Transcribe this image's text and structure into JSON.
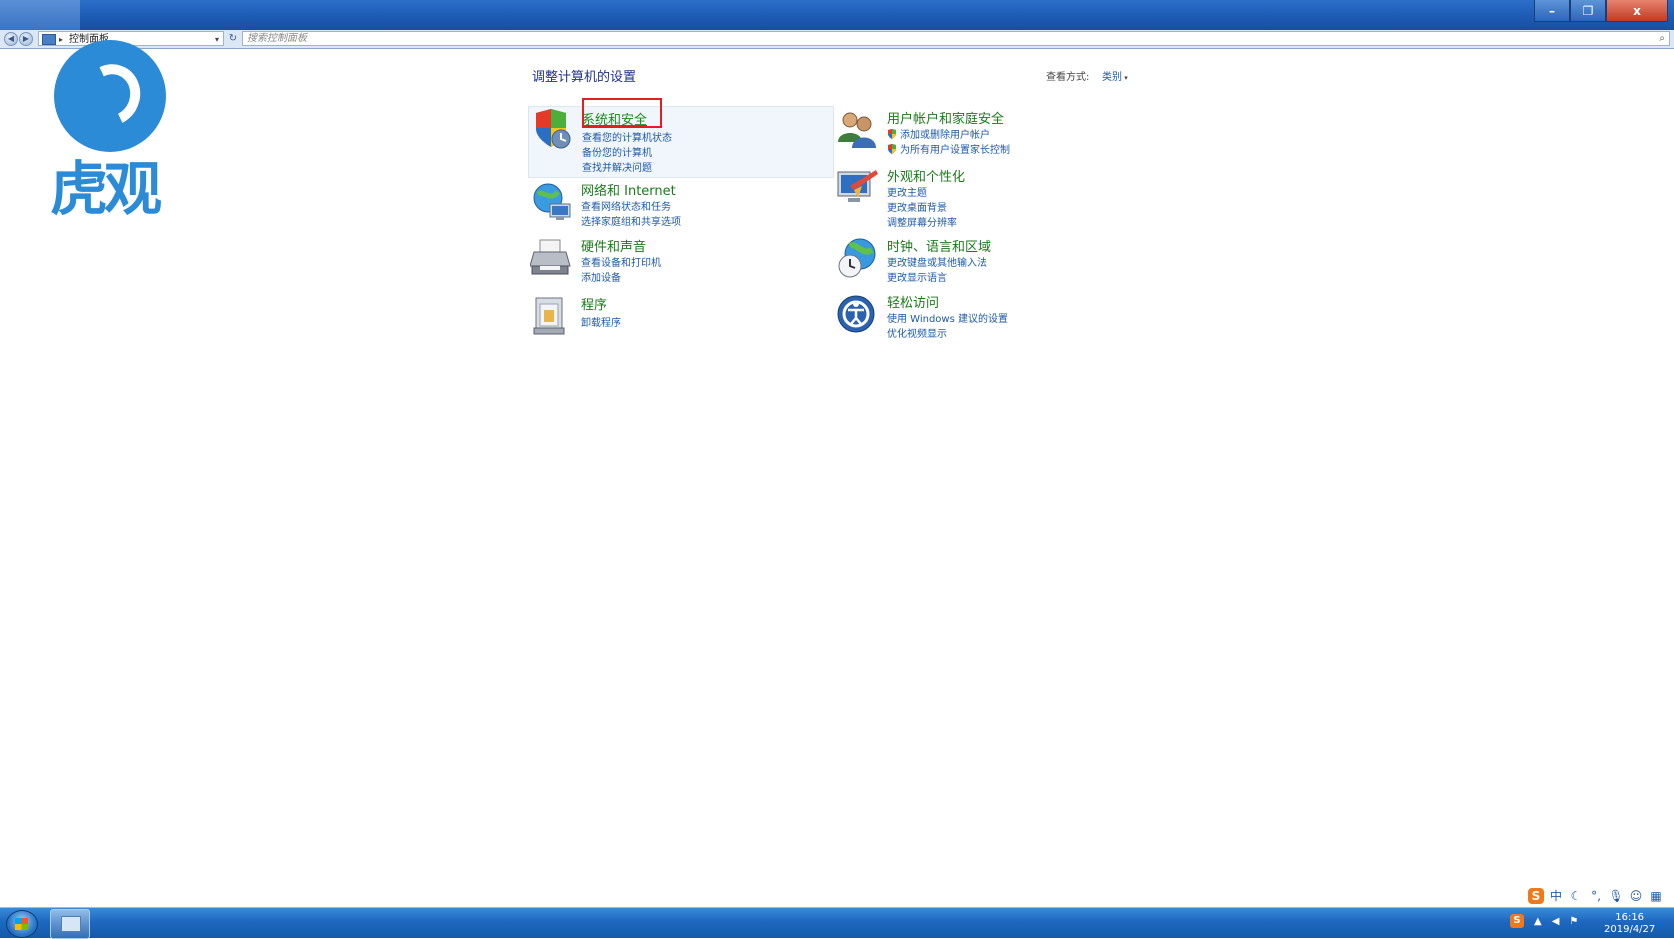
{
  "window": {
    "minimize": "–",
    "restore": "❐",
    "close": "x"
  },
  "address": {
    "breadcrumb": "控制面板",
    "search_placeholder": "搜索控制面板"
  },
  "logo": {
    "text": "虎观"
  },
  "main": {
    "title": "调整计算机的设置",
    "view_by_label": "查看方式:",
    "view_by_value": "类别"
  },
  "categories": [
    {
      "title": "系统和安全",
      "links": [
        "查看您的计算机状态",
        "备份您的计算机",
        "查找并解决问题"
      ]
    },
    {
      "title": "网络和 Internet",
      "links": [
        "查看网络状态和任务",
        "选择家庭组和共享选项"
      ]
    },
    {
      "title": "硬件和声音",
      "links": [
        "查看设备和打印机",
        "添加设备"
      ]
    },
    {
      "title": "程序",
      "links": [
        "卸载程序"
      ]
    },
    {
      "title": "用户帐户和家庭安全",
      "links": [
        "添加或删除用户帐户",
        "为所有用户设置家长控制"
      ]
    },
    {
      "title": "外观和个性化",
      "links": [
        "更改主题",
        "更改桌面背景",
        "调整屏幕分辨率"
      ]
    },
    {
      "title": "时钟、语言和区域",
      "links": [
        "更改键盘或其他输入法",
        "更改显示语言"
      ]
    },
    {
      "title": "轻松访问",
      "links": [
        "使用 Windows 建议的设置",
        "优化视频显示"
      ]
    }
  ],
  "ime": {
    "logo": "S",
    "lang": "中"
  },
  "taskbar": {
    "time": "16:16",
    "date": "2019/4/27"
  }
}
